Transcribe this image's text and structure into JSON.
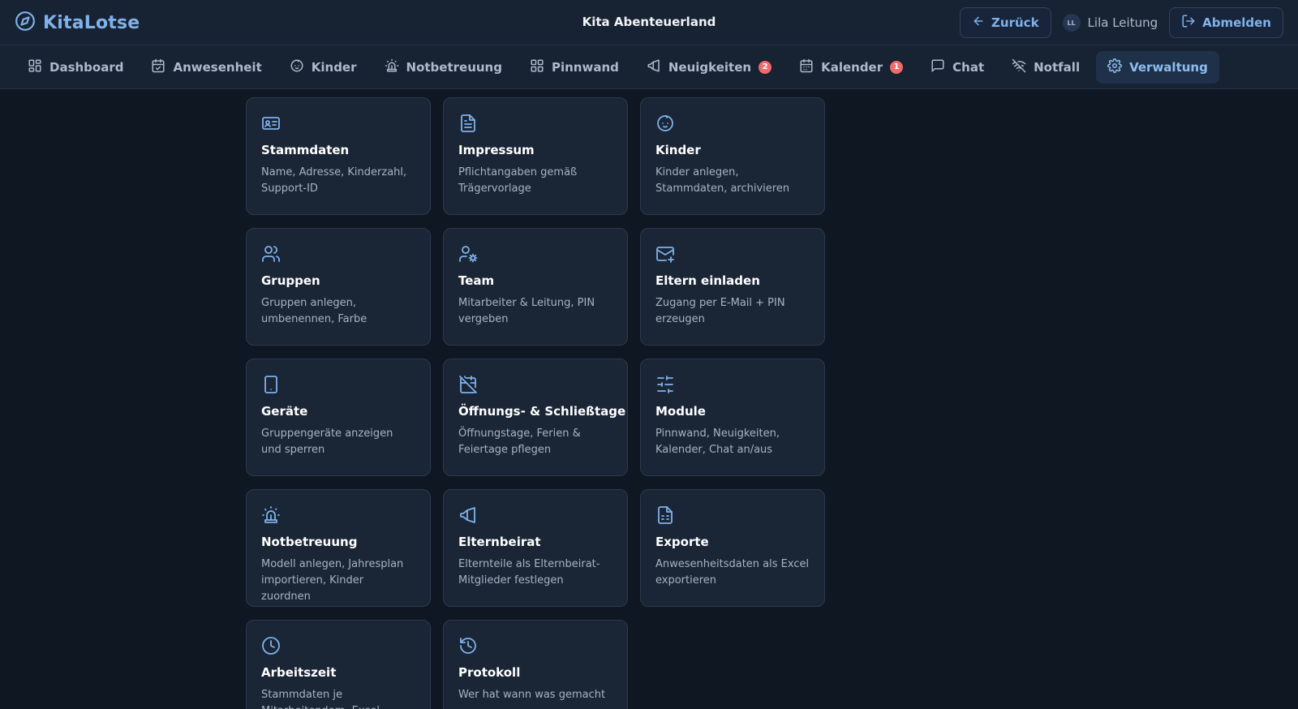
{
  "header": {
    "brand": "KitaLotse",
    "title": "Kita Abenteuerland",
    "back_label": "Zurück",
    "user_initials": "LL",
    "user_name": "Lila Leitung",
    "logout_label": "Abmelden"
  },
  "nav": {
    "items": [
      {
        "label": "Dashboard",
        "icon": "dashboard-icon"
      },
      {
        "label": "Anwesenheit",
        "icon": "calendar-check-icon"
      },
      {
        "label": "Kinder",
        "icon": "baby-icon"
      },
      {
        "label": "Notbetreuung",
        "icon": "siren-icon"
      },
      {
        "label": "Pinnwand",
        "icon": "grid-icon"
      },
      {
        "label": "Neuigkeiten",
        "icon": "megaphone-icon",
        "badge": "2"
      },
      {
        "label": "Kalender",
        "icon": "calendar-icon",
        "badge": "1"
      },
      {
        "label": "Chat",
        "icon": "chat-icon"
      },
      {
        "label": "Notfall",
        "icon": "wifi-off-icon"
      },
      {
        "label": "Verwaltung",
        "icon": "gear-icon",
        "active": true
      }
    ]
  },
  "cards": [
    {
      "title": "Stammdaten",
      "desc": "Name, Adresse, Kinderzahl, Support-ID",
      "icon": "id-card-icon"
    },
    {
      "title": "Impressum",
      "desc": "Pflichtangaben gemäß Trägervorlage",
      "icon": "document-icon"
    },
    {
      "title": "Kinder",
      "desc": "Kinder anlegen, Stammdaten, archivieren",
      "icon": "baby-icon"
    },
    {
      "title": "Gruppen",
      "desc": "Gruppen anlegen, umbenennen, Farbe",
      "icon": "users-icon"
    },
    {
      "title": "Team",
      "desc": "Mitarbeiter & Leitung, PIN vergeben",
      "icon": "user-cog-icon"
    },
    {
      "title": "Eltern einladen",
      "desc": "Zugang per E-Mail + PIN erzeugen",
      "icon": "mail-plus-icon"
    },
    {
      "title": "Geräte",
      "desc": "Gruppengeräte anzeigen und sperren",
      "icon": "tablet-icon"
    },
    {
      "title": "Öffnungs- & Schließtage",
      "desc": "Öffnungstage, Ferien & Feiertage pflegen",
      "icon": "calendar-off-icon"
    },
    {
      "title": "Module",
      "desc": "Pinnwand, Neuigkeiten, Kalender, Chat an/aus",
      "icon": "sliders-icon"
    },
    {
      "title": "Notbetreuung",
      "desc": "Modell anlegen, Jahresplan importieren, Kinder zuordnen",
      "icon": "siren-icon"
    },
    {
      "title": "Elternbeirat",
      "desc": "Elternteile als Elternbeirat-Mitglieder festlegen",
      "icon": "megaphone-icon"
    },
    {
      "title": "Exporte",
      "desc": "Anwesenheitsdaten als Excel exportieren",
      "icon": "spreadsheet-icon"
    },
    {
      "title": "Arbeitszeit",
      "desc": "Stammdaten je Mitarbeitendem, Excel-Export füllen",
      "icon": "clock-icon"
    },
    {
      "title": "Protokoll",
      "desc": "Wer hat wann was gemacht",
      "icon": "history-icon"
    }
  ],
  "colors": {
    "background": "#0f1722",
    "accent": "#7fb2ea",
    "badge": "#ef6b6b",
    "card": "#1a2536"
  }
}
